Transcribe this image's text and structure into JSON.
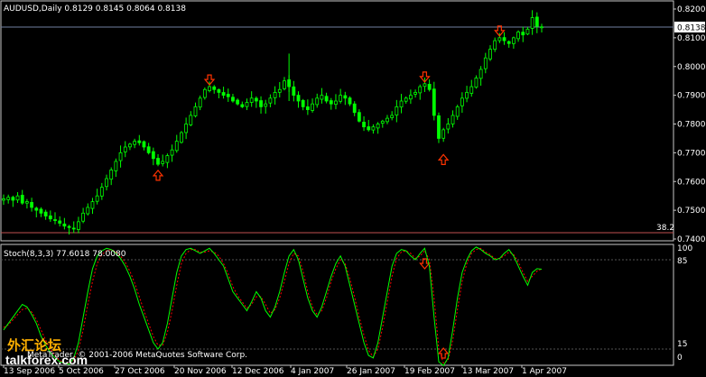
{
  "main_pane": {
    "symbol_header": "AUDUSD,Daily  0.8129 0.8145 0.8064 0.8138",
    "current_price_tag": "0.8138",
    "level_tag": "38.2",
    "price_ticks": [
      "0.8200",
      "0.8100",
      "0.8000",
      "0.7900",
      "0.7800",
      "0.7700",
      "0.7600",
      "0.7500",
      "0.7400"
    ]
  },
  "sub_pane": {
    "header": "Stoch(8,3,3) 77.6018 78.0080",
    "level_ticks": [
      "100",
      "85",
      "15",
      "0"
    ],
    "copyright": "MetaTrader, © 2001-2006 MetaQuotes Software Corp."
  },
  "time_axis": {
    "labels": [
      "13 Sep 2006",
      "5 Oct 2006",
      "27 Oct 2006",
      "20 Nov 2006",
      "12 Dec 2006",
      "4 Jan 2007",
      "26 Jan 2007",
      "19 Feb 2007",
      "13 Mar 2007",
      "1 Apr 2007"
    ]
  },
  "watermark": {
    "cn_text": "外汇论坛",
    "site": "talkforex.com"
  },
  "colors": {
    "background": "#000000",
    "candles": "#00ff00",
    "stoch_main": "#00ff00",
    "stoch_signal": "#ff0000",
    "arrow": "#ff3300",
    "grid_text": "#ffffff",
    "level_line": "#c05050"
  },
  "chart_data": [
    {
      "type": "candlestick",
      "title": "AUDUSD,Daily",
      "ylim": [
        0.74,
        0.82
      ],
      "ohlc_last": {
        "open": 0.8129,
        "high": 0.8145,
        "low": 0.8064,
        "close": 0.8138
      },
      "close_series": [
        0.754,
        0.7545,
        0.7535,
        0.755,
        0.7525,
        0.753,
        0.751,
        0.75,
        0.749,
        0.748,
        0.747,
        0.7465,
        0.7455,
        0.7445,
        0.744,
        0.7435,
        0.746,
        0.749,
        0.751,
        0.753,
        0.755,
        0.758,
        0.761,
        0.764,
        0.767,
        0.77,
        0.772,
        0.773,
        0.774,
        0.7735,
        0.772,
        0.77,
        0.768,
        0.766,
        0.767,
        0.769,
        0.771,
        0.774,
        0.777,
        0.78,
        0.783,
        0.786,
        0.789,
        0.792,
        0.793,
        0.792,
        0.791,
        0.79,
        0.7895,
        0.788,
        0.787,
        0.786,
        0.7875,
        0.789,
        0.788,
        0.786,
        0.787,
        0.789,
        0.791,
        0.792,
        0.795,
        0.793,
        0.79,
        0.788,
        0.786,
        0.785,
        0.787,
        0.789,
        0.79,
        0.788,
        0.787,
        0.788,
        0.79,
        0.789,
        0.787,
        0.784,
        0.781,
        0.779,
        0.778,
        0.779,
        0.78,
        0.781,
        0.782,
        0.783,
        0.786,
        0.788,
        0.789,
        0.79,
        0.791,
        0.793,
        0.794,
        0.792,
        0.783,
        0.775,
        0.778,
        0.78,
        0.783,
        0.786,
        0.789,
        0.791,
        0.793,
        0.796,
        0.799,
        0.803,
        0.806,
        0.809,
        0.81,
        0.809,
        0.808,
        0.81,
        0.812,
        0.811,
        0.813,
        0.817,
        0.814,
        0.8138
      ],
      "arrows": [
        {
          "dir": "up",
          "index": 33,
          "price": 0.762
        },
        {
          "dir": "down",
          "index": 44,
          "price": 0.7955
        },
        {
          "dir": "down",
          "index": 90,
          "price": 0.7965
        },
        {
          "dir": "up",
          "index": 94,
          "price": 0.7675
        },
        {
          "dir": "down",
          "index": 106,
          "price": 0.8125
        }
      ]
    },
    {
      "type": "line",
      "title": "Stoch(8,3,3)",
      "ylim": [
        0,
        100
      ],
      "levels": [
        85,
        15
      ],
      "series": [
        {
          "name": "%K",
          "values": [
            30,
            35,
            40,
            45,
            50,
            48,
            42,
            35,
            25,
            18,
            12,
            8,
            5,
            4,
            3,
            8,
            20,
            40,
            60,
            78,
            88,
            92,
            94,
            93,
            90,
            86,
            80,
            72,
            62,
            50,
            40,
            30,
            20,
            15,
            20,
            35,
            55,
            75,
            88,
            93,
            94,
            92,
            90,
            92,
            94,
            90,
            85,
            80,
            70,
            60,
            55,
            50,
            45,
            52,
            60,
            55,
            45,
            40,
            48,
            60,
            75,
            88,
            93,
            85,
            70,
            55,
            45,
            40,
            48,
            60,
            72,
            82,
            88,
            80,
            65,
            50,
            35,
            20,
            10,
            8,
            20,
            40,
            60,
            80,
            90,
            93,
            92,
            88,
            85,
            90,
            94,
            80,
            40,
            5,
            2,
            8,
            30,
            55,
            75,
            85,
            92,
            95,
            93,
            90,
            88,
            85,
            86,
            90,
            93,
            88,
            80,
            72,
            65,
            75,
            78,
            77.6
          ]
        },
        {
          "name": "%D",
          "values": [
            32,
            34,
            38,
            42,
            46,
            47,
            44,
            38,
            30,
            22,
            15,
            10,
            6,
            4,
            4,
            6,
            14,
            30,
            50,
            68,
            82,
            89,
            92,
            93,
            91,
            88,
            83,
            76,
            67,
            56,
            45,
            35,
            25,
            18,
            18,
            28,
            45,
            65,
            82,
            90,
            93,
            93,
            91,
            91,
            92,
            91,
            88,
            82,
            74,
            64,
            57,
            52,
            47,
            50,
            56,
            56,
            50,
            43,
            46,
            55,
            68,
            82,
            90,
            88,
            76,
            60,
            48,
            42,
            45,
            55,
            68,
            78,
            85,
            82,
            70,
            56,
            40,
            26,
            14,
            9,
            15,
            32,
            52,
            72,
            86,
            91,
            92,
            90,
            86,
            88,
            92,
            85,
            55,
            15,
            4,
            6,
            22,
            46,
            68,
            82,
            90,
            93,
            94,
            91,
            89,
            86,
            86,
            88,
            91,
            89,
            83,
            75,
            68,
            72,
            76,
            78.0
          ]
        }
      ]
    }
  ]
}
